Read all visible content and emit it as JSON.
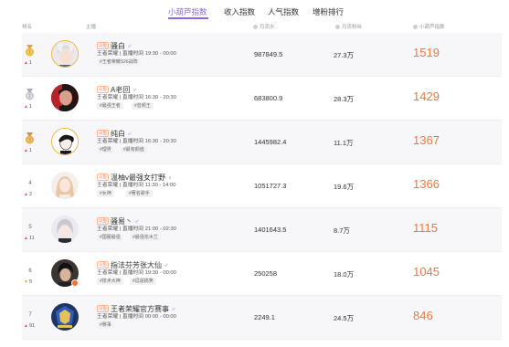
{
  "tabs": [
    {
      "label": "小葫芦指数",
      "active": true
    },
    {
      "label": "收入指数",
      "active": false
    },
    {
      "label": "人气指数",
      "active": false
    },
    {
      "label": "增粉排行",
      "active": false
    }
  ],
  "header": {
    "rank": "排名",
    "streamer": "主播",
    "col_flow": "月流水",
    "col_fans": "月流粉丝",
    "col_index": "小葫芦指数"
  },
  "colors": {
    "accent": "#8c67f2",
    "score": "#f0773b",
    "rank_up": "#e94c4c",
    "rank_down": "#f0a020",
    "medal_gold": "#f1b53a",
    "medal_silver": "#bfc4cc"
  },
  "rows": [
    {
      "rank": "",
      "medal": "gold",
      "direction": "up",
      "change": "1",
      "platform": "斗鱼",
      "name": "骚白",
      "gender": "male",
      "meta": "王者荣耀 | 直播时间 19:30 - 00:00",
      "tags": [
        "#王者荣耀S26战阵"
      ],
      "flow": "987849.5",
      "fans": "27.3万",
      "score": "1519",
      "avatar_icon": "avatar-bunny-hat-icon",
      "live": false
    },
    {
      "rank": "",
      "medal": "silver",
      "direction": "up",
      "change": "1",
      "platform": "斗鱼",
      "name": "A老回",
      "gender": "male",
      "meta": "王者荣耀 | 直播时间 16:30 - 20:30",
      "tags": [
        "#最强王者",
        "#音频王"
      ],
      "flow": "683800.9",
      "fans": "28.3万",
      "score": "1429",
      "avatar_icon": "avatar-man-red-light-icon",
      "live": false
    },
    {
      "rank": "",
      "medal": "bronze",
      "direction": "up",
      "change": "1",
      "platform": "斗鱼",
      "name": "纯白",
      "gender": "male",
      "meta": "王者荣耀 | 直播时间 16:30 - 20:30",
      "tags": [
        "#理男",
        "#最有颜值"
      ],
      "flow": "1445982.4",
      "fans": "11.1万",
      "score": "1367",
      "avatar_icon": "avatar-cartoon-man-icon",
      "live": false
    },
    {
      "rank": "4",
      "medal": "",
      "direction": "up",
      "change": "2",
      "platform": "斗鱼",
      "name": "温柚v最强女打野",
      "gender": "female",
      "meta": "王者荣耀 | 直播时间 11:30 - 14:00",
      "tags": [
        "#女神",
        "#著名歌手"
      ],
      "flow": "1051727.3",
      "fans": "19.6万",
      "score": "1366",
      "avatar_icon": "avatar-girl-icon",
      "live": false
    },
    {
      "rank": "5",
      "medal": "",
      "direction": "up",
      "change": "11",
      "platform": "斗鱼",
      "name": "骚易丶",
      "gender": "male",
      "meta": "王者荣耀 | 直播时间 21:00 - 02:30",
      "tags": [
        "#国服最强",
        "#最强花木兰"
      ],
      "flow": "1401643.5",
      "fans": "8.7万",
      "score": "1115",
      "avatar_icon": "avatar-silver-hair-icon",
      "live": false
    },
    {
      "rank": "6",
      "medal": "",
      "direction": "down",
      "change": "5",
      "platform": "斗鱼",
      "name": "指法芬芳张大仙",
      "gender": "male",
      "meta": "王者荣耀 | 直播时间 19:30 - 00:00",
      "tags": [
        "#技术大神",
        "#逗逼搞笑"
      ],
      "flow": "250258",
      "fans": "18.0万",
      "score": "1045",
      "avatar_icon": "avatar-dark-man-icon",
      "live": true
    },
    {
      "rank": "7",
      "medal": "",
      "direction": "up",
      "change": "91",
      "platform": "斗鱼",
      "name": "王者荣耀官方赛事",
      "gender": "male",
      "meta": "王者荣耀 | 直播时间 00:00 - 00:00",
      "tags": [
        "#赛事"
      ],
      "flow": "2249.1",
      "fans": "24.5万",
      "score": "846",
      "avatar_icon": "avatar-kpl-logo-icon",
      "live": false
    }
  ]
}
